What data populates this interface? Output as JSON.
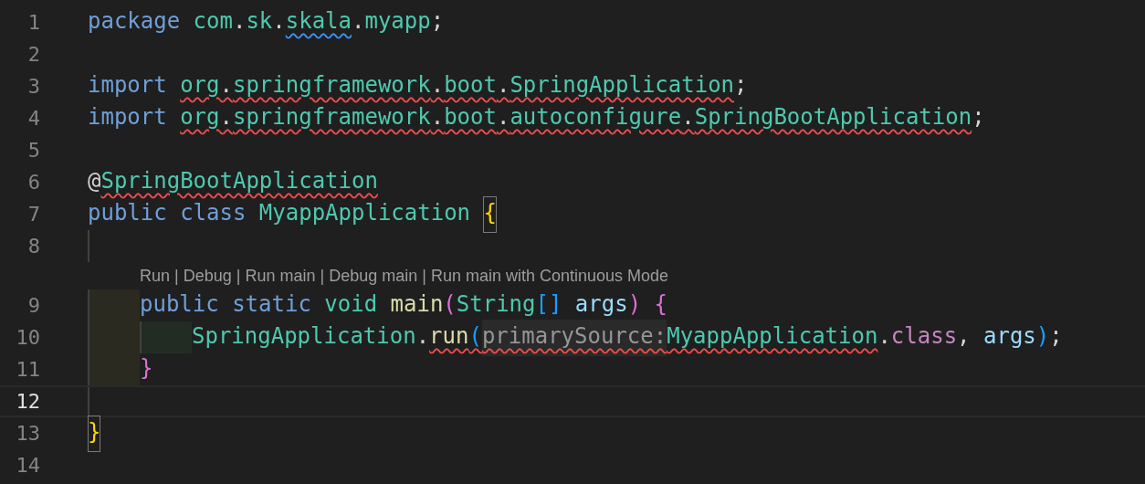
{
  "editor": {
    "lines": [
      {
        "kind": "code",
        "number": "1",
        "selected": false,
        "tokens": [
          {
            "kind": "keyword",
            "text": "package ",
            "info": false
          },
          {
            "kind": "type",
            "text": "com",
            "info": false
          },
          {
            "kind": "punct",
            "text": ".",
            "info": false
          },
          {
            "kind": "type",
            "text": "sk",
            "info": false
          },
          {
            "kind": "punct",
            "text": ".",
            "info": false
          },
          {
            "kind": "type",
            "text": "skala",
            "info": true
          },
          {
            "kind": "punct",
            "text": ".",
            "info": false
          },
          {
            "kind": "type",
            "text": "myapp",
            "info": false
          },
          {
            "kind": "punct",
            "text": ";",
            "info": false
          }
        ]
      },
      {
        "kind": "code",
        "number": "2",
        "selected": false
      },
      {
        "kind": "code",
        "number": "3",
        "selected": false,
        "tokens": [
          {
            "kind": "keyword",
            "text": "import ",
            "error": false
          },
          {
            "kind": "type",
            "text": "org",
            "error": true
          },
          {
            "kind": "punct",
            "text": ".",
            "error": true
          },
          {
            "kind": "type",
            "text": "springframework",
            "error": true
          },
          {
            "kind": "punct",
            "text": ".",
            "error": true
          },
          {
            "kind": "type",
            "text": "boot",
            "error": true
          },
          {
            "kind": "punct",
            "text": ".",
            "error": true
          },
          {
            "kind": "type",
            "text": "SpringApplication",
            "error": true
          },
          {
            "kind": "punct",
            "text": ";",
            "error": false
          }
        ]
      },
      {
        "kind": "code",
        "number": "4",
        "selected": false,
        "tokens": [
          {
            "kind": "keyword",
            "text": "import ",
            "error": false
          },
          {
            "kind": "type",
            "text": "org",
            "error": true
          },
          {
            "kind": "punct",
            "text": ".",
            "error": true
          },
          {
            "kind": "type",
            "text": "springframework",
            "error": true
          },
          {
            "kind": "punct",
            "text": ".",
            "error": true
          },
          {
            "kind": "type",
            "text": "boot",
            "error": true
          },
          {
            "kind": "punct",
            "text": ".",
            "error": true
          },
          {
            "kind": "type",
            "text": "autoconfigure",
            "error": true
          },
          {
            "kind": "punct",
            "text": ".",
            "error": true
          },
          {
            "kind": "type",
            "text": "SpringBootApplication",
            "error": true
          },
          {
            "kind": "punct",
            "text": ";",
            "error": false
          }
        ]
      },
      {
        "kind": "code",
        "number": "5",
        "selected": false
      },
      {
        "kind": "code",
        "number": "6",
        "selected": false,
        "tokens": [
          {
            "kind": "punct",
            "text": "@",
            "error": false
          },
          {
            "kind": "type",
            "text": "SpringBootApplication",
            "error": true
          }
        ]
      },
      {
        "kind": "code",
        "number": "7",
        "selected": false,
        "tokens": [
          {
            "kind": "keyword",
            "text": "public class ",
            "matched": false
          },
          {
            "kind": "type",
            "text": "MyappApplication ",
            "matched": false
          },
          {
            "kind": "bracket1",
            "text": "{",
            "matched": true
          }
        ],
        "children": [
          {
            "kind": "code",
            "number": "8",
            "selected": false
          },
          {
            "kind": "codelens",
            "separator": "|",
            "actions": [
              "Run",
              "Debug",
              "Run main",
              "Debug main",
              "Run main with Continuous Mode"
            ]
          },
          {
            "kind": "code",
            "number": "9",
            "selected": false,
            "tokens": [
              {
                "kind": "keyword",
                "text": "public static "
              },
              {
                "kind": "type",
                "text": "void "
              },
              {
                "kind": "func",
                "text": "main"
              },
              {
                "kind": "bracket2",
                "text": "("
              },
              {
                "kind": "type",
                "text": "String"
              },
              {
                "kind": "bracket3",
                "text": "[]"
              },
              {
                "kind": "param",
                "text": " args"
              },
              {
                "kind": "bracket2",
                "text": ")"
              },
              {
                "kind": "bracket2",
                "text": " {"
              }
            ],
            "children": [
              {
                "kind": "code",
                "number": "10",
                "selected": false,
                "tokens": [
                  {
                    "kind": "type",
                    "text": "SpringApplication",
                    "error": false
                  },
                  {
                    "kind": "punct",
                    "text": ".",
                    "error": false
                  },
                  {
                    "kind": "func",
                    "text": "run",
                    "error": true
                  },
                  {
                    "kind": "bracket3",
                    "text": "(",
                    "error": true
                  },
                  {
                    "kind": "hint",
                    "text": "primarySource:",
                    "error": true
                  },
                  {
                    "kind": "type",
                    "text": "MyappApplication",
                    "error": true
                  },
                  {
                    "kind": "punct",
                    "text": ".",
                    "error": false
                  },
                  {
                    "kind": "control",
                    "text": "class",
                    "error": false
                  },
                  {
                    "kind": "punct",
                    "text": ", ",
                    "error": false
                  },
                  {
                    "kind": "param",
                    "text": "args",
                    "error": false
                  },
                  {
                    "kind": "bracket3",
                    "text": ")",
                    "error": false
                  },
                  {
                    "kind": "punct",
                    "text": ";",
                    "error": false
                  }
                ]
              }
            ]
          },
          {
            "kind": "code",
            "number": "11",
            "selected": false,
            "tokens": [
              {
                "kind": "bracket2",
                "text": "}"
              }
            ]
          },
          {
            "kind": "code",
            "number": "12",
            "selected": true
          }
        ]
      },
      {
        "kind": "code",
        "number": "13",
        "selected": false,
        "tokens": [
          {
            "kind": "bracket1",
            "text": "}",
            "matched": true
          }
        ]
      },
      {
        "kind": "code",
        "number": "14",
        "selected": false
      }
    ]
  }
}
